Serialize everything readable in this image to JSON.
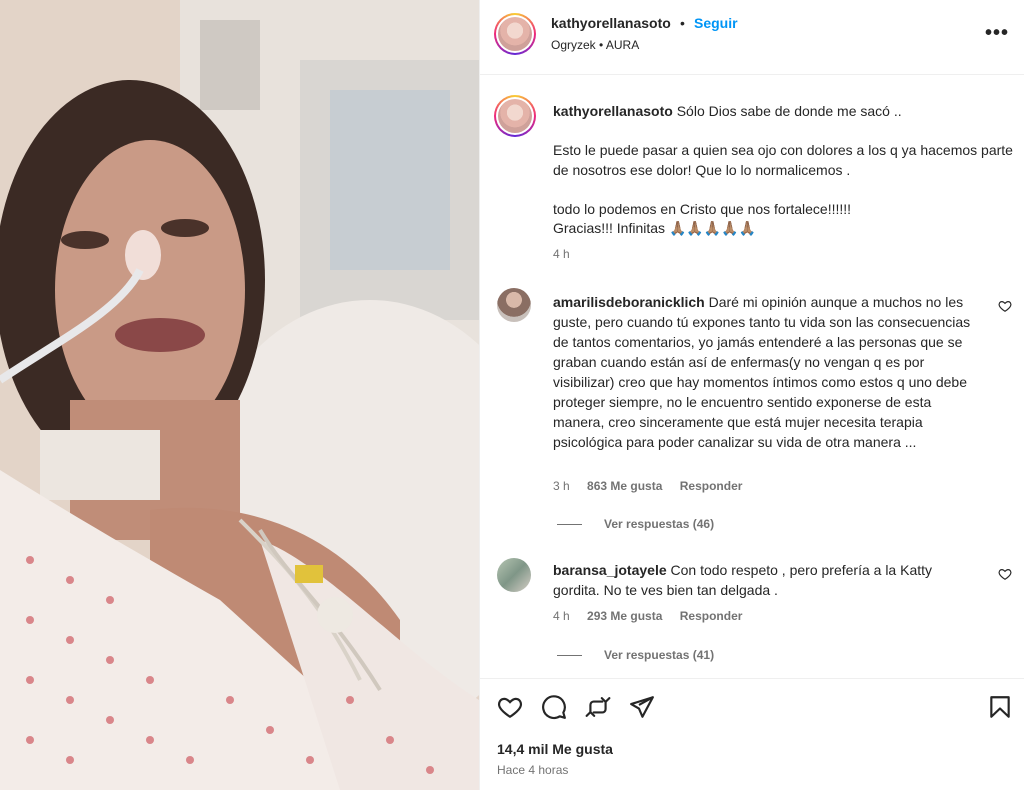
{
  "post": {
    "username": "kathyorellanasoto",
    "follow_label": "Seguir",
    "dot": "•",
    "subtitle": "Ogryzek • AURA",
    "more_icon": "more-horizontal-icon"
  },
  "caption": {
    "username": "kathyorellanasoto",
    "line1": "Sólo Dios sabe de donde me sacó ..",
    "para2": "Esto le puede pasar a quien sea ojo con dolores a los q ya hacemos parte de nosotros ese dolor! Que lo lo normalicemos .",
    "para3a": "todo lo podemos en Cristo que nos fortalece!!!!!!",
    "para3b": "Gracias!!! Infinitas",
    "emojis": "🙏🏽🙏🏽🙏🏽🙏🏽🙏🏽",
    "time": "4 h"
  },
  "comments": [
    {
      "username": "amarilisdeboranicklich",
      "text": "Daré mi opinión aunque a muchos no les guste, pero cuando tú expones tanto tu vida son las consecuencias de tantos comentarios, yo jamás entenderé a las personas que se graban cuando están así de enfermas(y no vengan q es por visibilizar) creo que hay momentos íntimos como estos q uno debe proteger siempre, no le encuentro sentido exponerse de esta manera, creo sinceramente que está mujer necesita terapia psicológica para poder canalizar su vida de otra manera ...",
      "time": "3 h",
      "likes": "863 Me gusta",
      "reply": "Responder",
      "view_replies": "Ver respuestas (46)"
    },
    {
      "username": "baransa_jotayele",
      "text": "Con todo respeto , pero prefería a la Katty gordita. No te ves bien tan delgada .",
      "time": "4 h",
      "likes": "293 Me gusta",
      "reply": "Responder",
      "view_replies": "Ver respuestas (41)"
    }
  ],
  "footer": {
    "likes": "14,4 mil Me gusta",
    "posted": "Hace 4 horas"
  },
  "icons": {
    "like": "heart-icon",
    "comment": "comment-icon",
    "share": "repost-icon",
    "send": "send-icon",
    "save": "bookmark-icon"
  }
}
